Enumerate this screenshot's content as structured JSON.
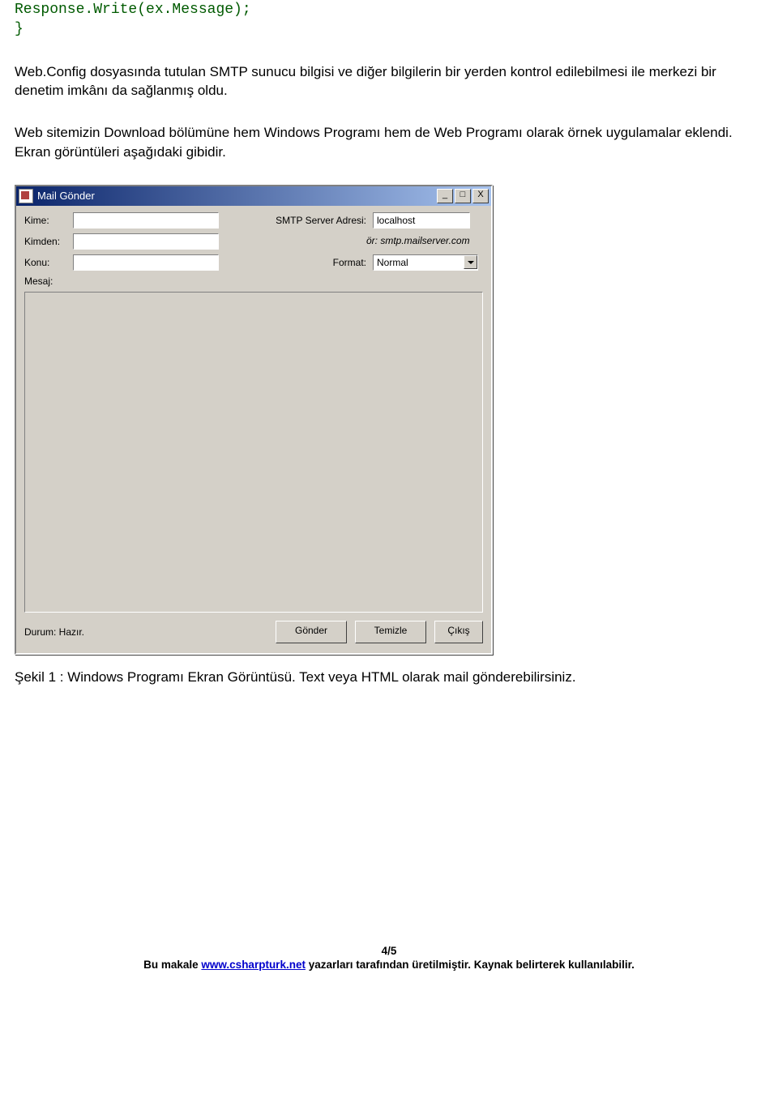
{
  "code": {
    "line1": "Response.Write(ex.Message);",
    "line2": "}"
  },
  "para1": "Web.Config dosyasında tutulan SMTP sunucu bilgisi ve diğer bilgilerin bir yerden kontrol edilebilmesi ile merkezi bir denetim imkânı da sağlanmış oldu.",
  "para2": "Web sitemizin Download bölümüne hem Windows Programı hem de Web Programı olarak örnek uygulamalar eklendi. Ekran görüntüleri aşağıdaki gibidir.",
  "window": {
    "title": "Mail Gönder",
    "minimize": "_",
    "maximize": "□",
    "close": "X",
    "labels": {
      "kime": "Kime:",
      "kimden": "Kimden:",
      "konu": "Konu:",
      "mesaj": "Mesaj:",
      "smtp": "SMTP Server Adresi:",
      "smtp_hint": "ör: smtp.mailserver.com",
      "format": "Format:"
    },
    "values": {
      "kime": "",
      "kimden": "",
      "konu": "",
      "smtp": "localhost",
      "format": "Normal"
    },
    "status": "Durum: Hazır.",
    "buttons": {
      "gonder": "Gönder",
      "temizle": "Temizle",
      "cikis": "Çıkış"
    }
  },
  "caption": "Şekil 1 : Windows Programı Ekran Görüntüsü. Text veya HTML olarak mail gönderebilirsiniz.",
  "footer": {
    "page": "4/5",
    "pre": "Bu makale ",
    "link": "www.csharpturk.net",
    "post": " yazarları tarafından üretilmiştir. Kaynak belirterek kullanılabilir."
  }
}
